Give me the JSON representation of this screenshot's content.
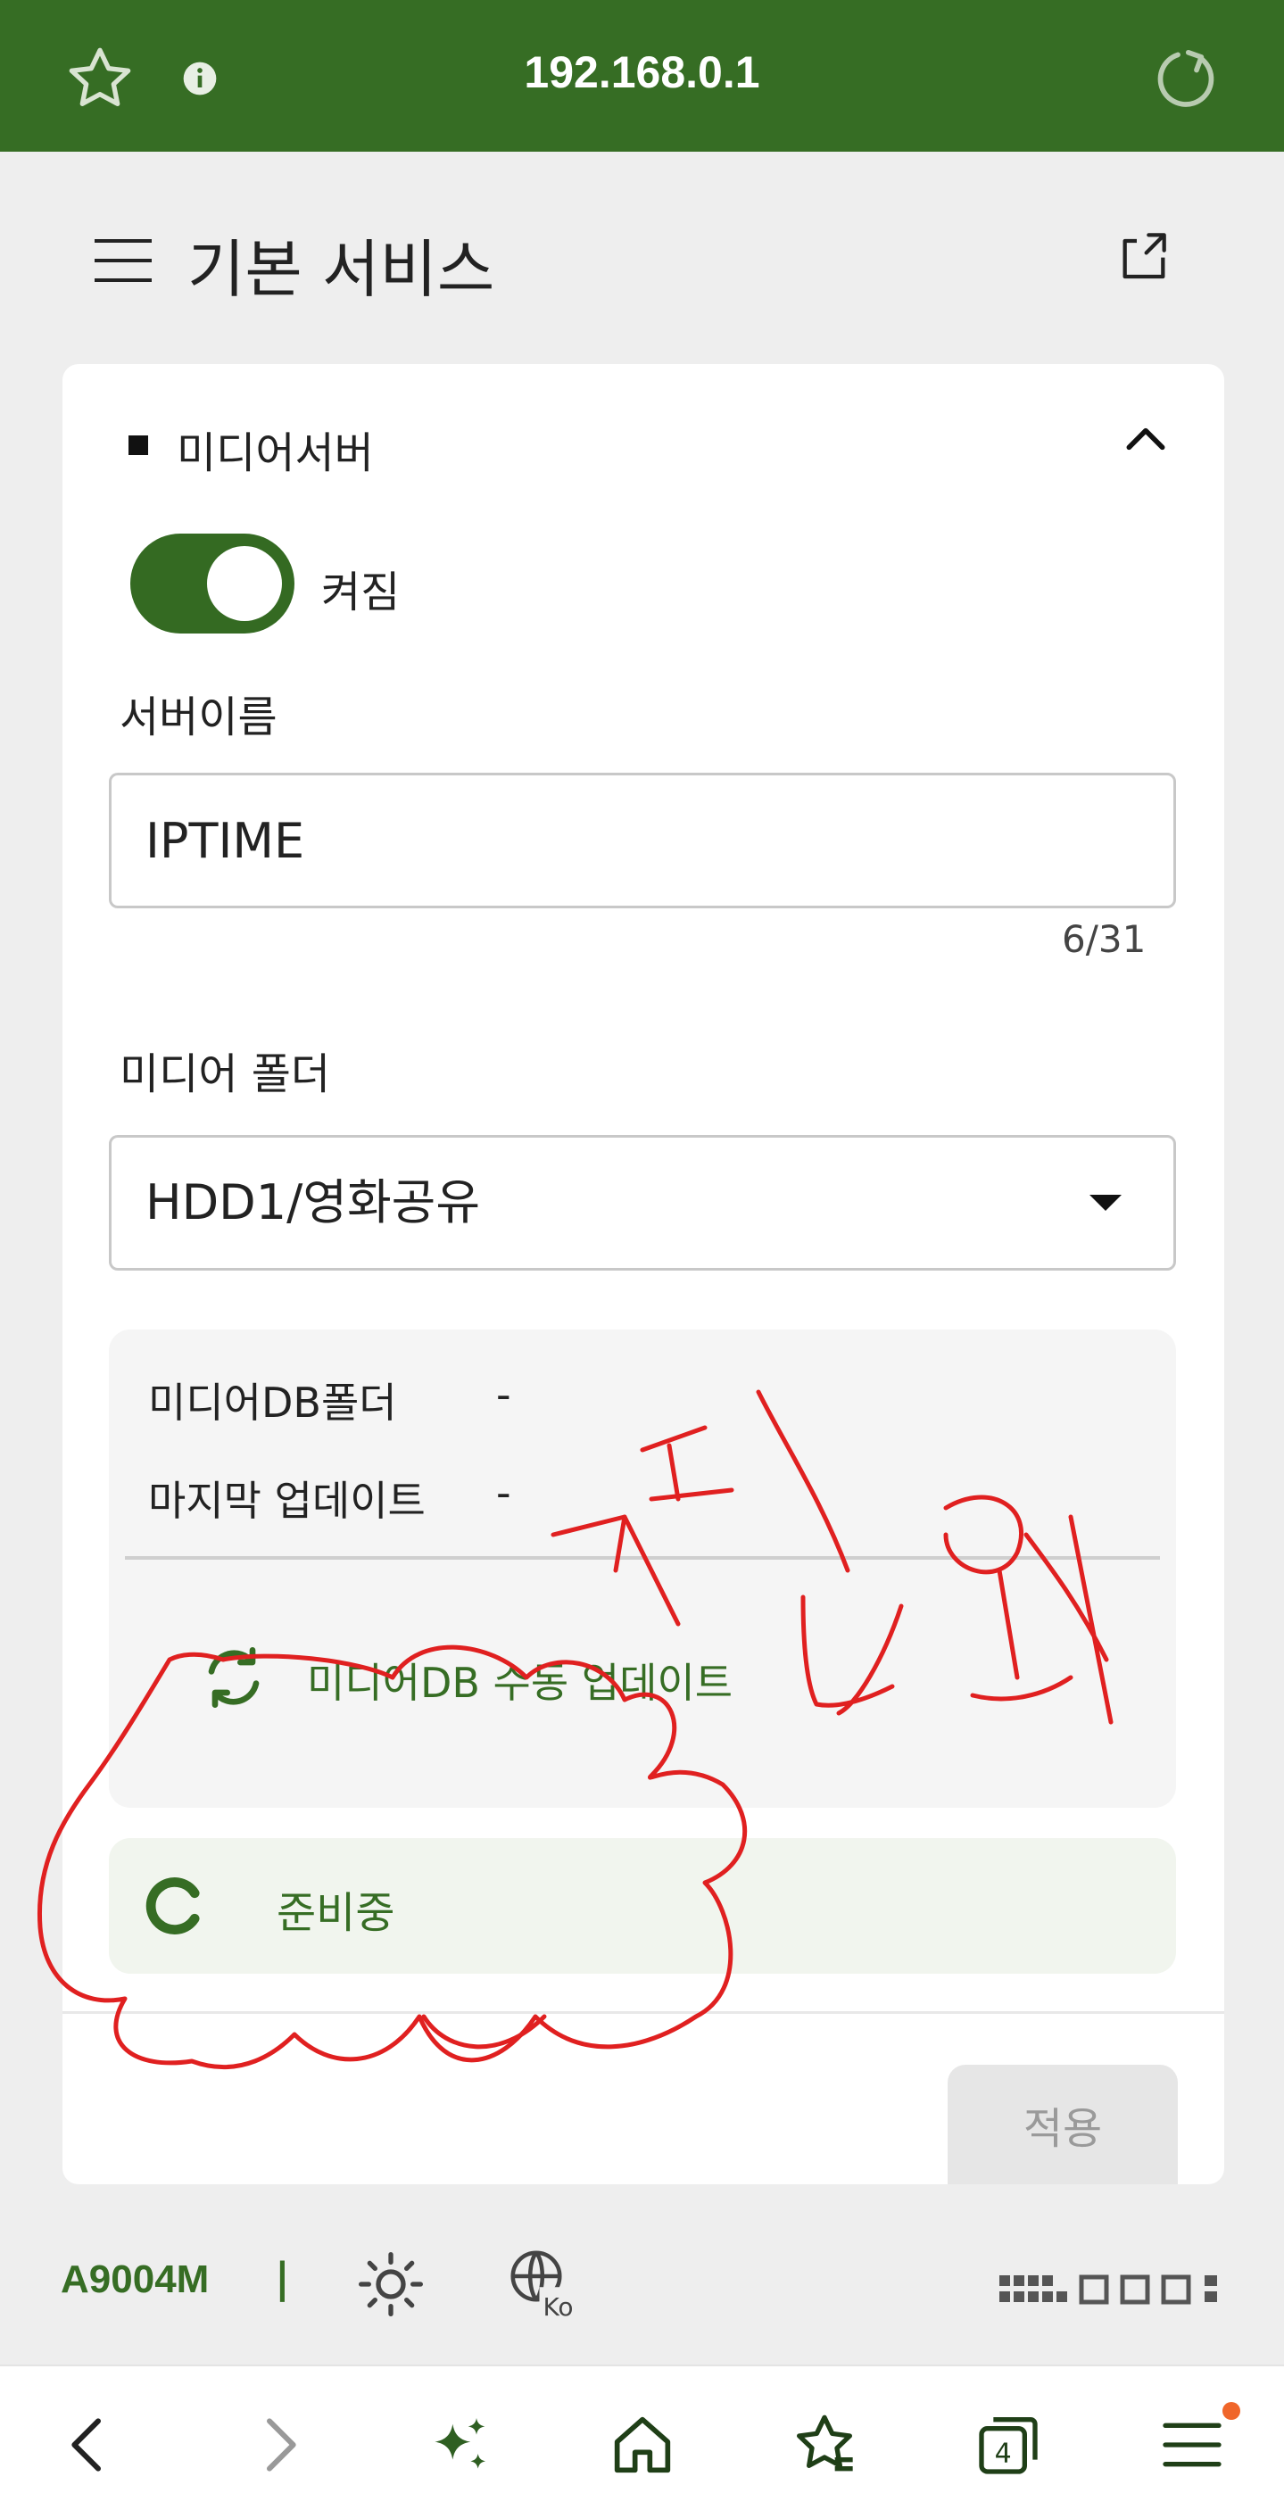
{
  "browser": {
    "url": "192.168.0.1",
    "icons": {
      "bookmark": "star-icon",
      "info": "info-icon",
      "reload": "reload-icon"
    }
  },
  "header": {
    "title": "기본 서비스",
    "icons": {
      "menu": "hamburger-icon",
      "share": "share-icon"
    }
  },
  "section": {
    "title": "미디어서버",
    "toggle_label": "켜짐",
    "toggle_on": true,
    "server_name_label": "서버이름",
    "server_name_value": "IPTIME",
    "server_name_counter": "6/31",
    "media_folder_label": "미디어 폴더",
    "media_folder_value": "HDD1/영화공유",
    "db_folder_label": "미디어DB폴더",
    "db_folder_value": "-",
    "last_update_label": "마지막 업데이트",
    "last_update_value": "-",
    "manual_update_label": "미디어DB 수동 업데이트",
    "status_label": "준비중",
    "apply_label": "적용"
  },
  "statusbar": {
    "model": "A9004M",
    "separator": "|",
    "globe_lang": "Ko"
  },
  "navbar": {
    "tab_count": "4",
    "icons": [
      "back-icon",
      "forward-icon",
      "sparkle-icon",
      "home-icon",
      "favorites-icon",
      "tabs-icon",
      "menu-icon"
    ]
  },
  "colors": {
    "brand": "#366d24",
    "annotation": "#e02020",
    "notification": "#f0662a"
  }
}
